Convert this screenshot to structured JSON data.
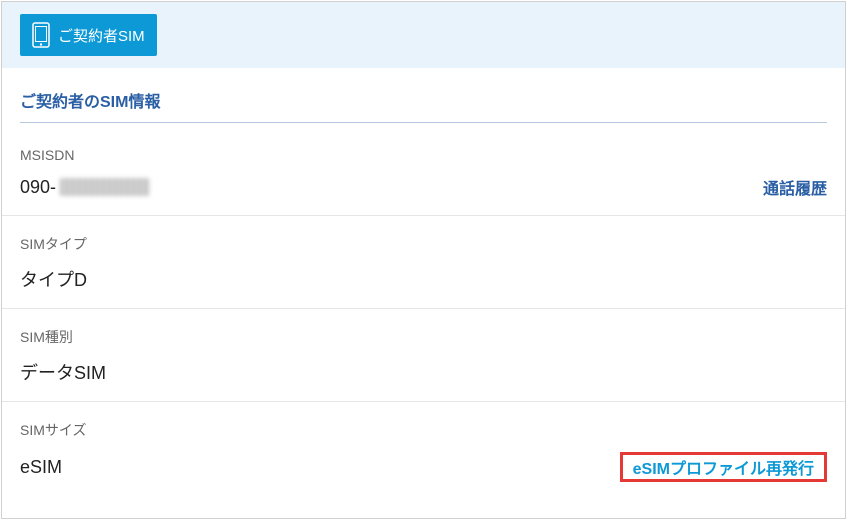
{
  "tab": {
    "label": "ご契約者SIM"
  },
  "section_title": "ご契約者のSIM情報",
  "fields": {
    "msisdn": {
      "label": "MSISDN",
      "value_prefix": "090-",
      "action": "通話履歴"
    },
    "sim_type": {
      "label": "SIMタイプ",
      "value": "タイプD"
    },
    "sim_category": {
      "label": "SIM種別",
      "value": "データSIM"
    },
    "sim_size": {
      "label": "SIMサイズ",
      "value": "eSIM",
      "action": "eSIMプロファイル再発行"
    }
  }
}
